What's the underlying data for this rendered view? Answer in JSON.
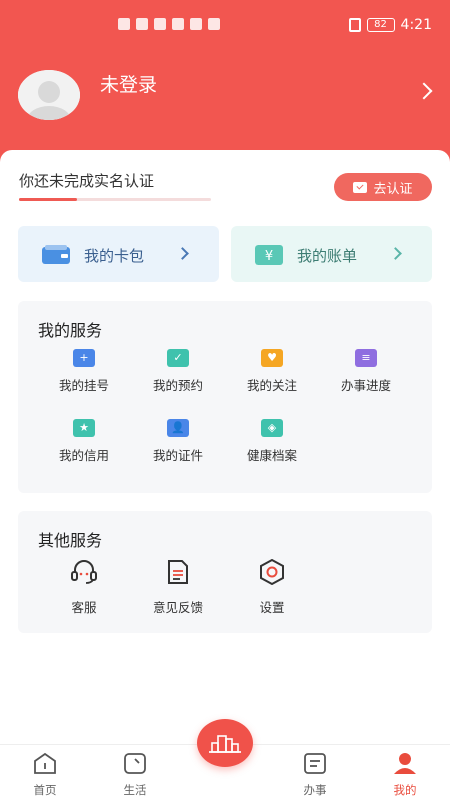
{
  "status_bar": {
    "battery": "82",
    "time": "4:21"
  },
  "profile": {
    "login_text": "未登录"
  },
  "verification": {
    "prompt": "你还未完成实名认证",
    "button_label": "去认证",
    "progress": 0.3
  },
  "quick_cards": [
    {
      "label": "我的卡包"
    },
    {
      "label": "我的账单",
      "icon_glyph": "¥"
    }
  ],
  "my_services": {
    "title": "我的服务",
    "items": [
      {
        "label": "我的挂号",
        "icon": "register-icon",
        "color": "#4a86e8",
        "glyph": "+"
      },
      {
        "label": "我的预约",
        "icon": "appointment-icon",
        "color": "#3fc2ad",
        "glyph": "✓"
      },
      {
        "label": "我的关注",
        "icon": "heart-icon",
        "color": "#f5a623",
        "glyph": "♥"
      },
      {
        "label": "办事进度",
        "icon": "progress-icon",
        "color": "#8f6ee0",
        "glyph": "≡"
      },
      {
        "label": "我的信用",
        "icon": "credit-shield-icon",
        "color": "#3fc2ad",
        "glyph": "★"
      },
      {
        "label": "我的证件",
        "icon": "id-card-icon",
        "color": "#4a86e8",
        "glyph": "👤"
      },
      {
        "label": "健康档案",
        "icon": "health-record-icon",
        "color": "#3fc2ad",
        "glyph": "◈"
      }
    ]
  },
  "other_services": {
    "title": "其他服务",
    "items": [
      {
        "label": "客服",
        "icon": "headset-icon"
      },
      {
        "label": "意见反馈",
        "icon": "feedback-document-icon"
      },
      {
        "label": "设置",
        "icon": "settings-hexagon-icon"
      }
    ]
  },
  "tabbar": {
    "tabs": [
      {
        "label": "首页",
        "icon": "home-icon"
      },
      {
        "label": "生活",
        "icon": "life-icon"
      },
      {
        "label": "办事",
        "icon": "affairs-icon"
      },
      {
        "label": "我的",
        "icon": "profile-icon",
        "active": true
      }
    ]
  },
  "colors": {
    "primary": "#f25650",
    "accent": "#e94c3d"
  }
}
